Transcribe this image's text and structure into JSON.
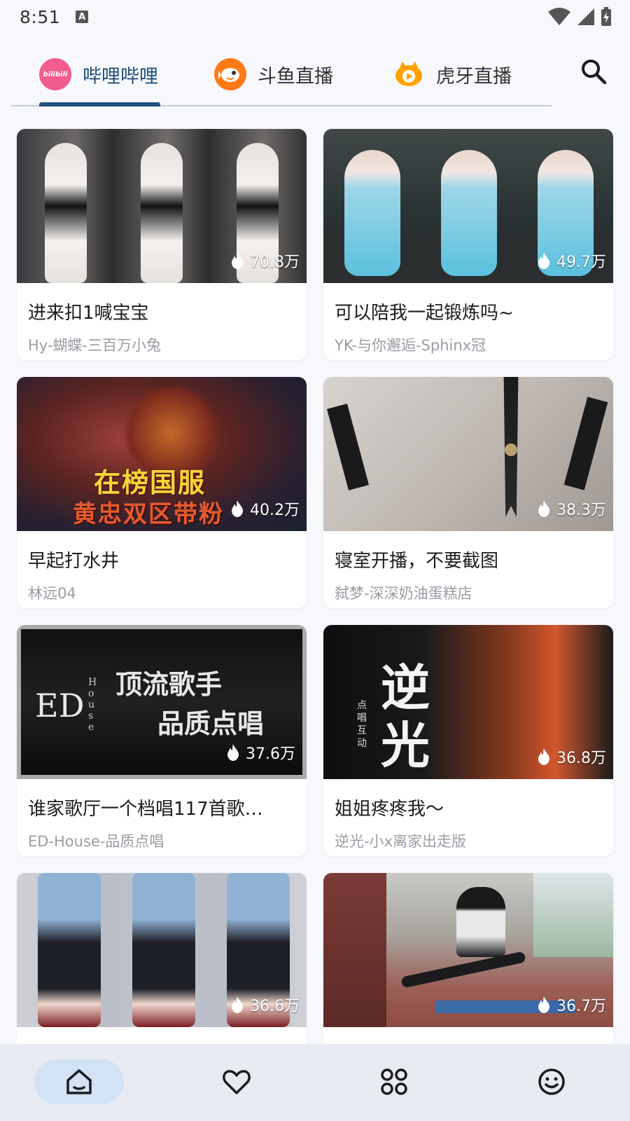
{
  "status": {
    "time": "8:51",
    "indicator": "A"
  },
  "tabs": [
    {
      "label": "哔哩哔哩",
      "logo_text": "bilibili",
      "active": true,
      "color": "#f25d8e"
    },
    {
      "label": "斗鱼直播",
      "active": false,
      "color": "#ff7a16"
    },
    {
      "label": "虎牙直播",
      "active": false,
      "color": "#ffa200"
    }
  ],
  "thumb_text": {
    "card3_banner_top": "在榜国服",
    "card3_banner_bottom": "黄忠双区带粉",
    "card5_line1": "顶流歌手",
    "card5_line2": "品质点唱",
    "card5_logo": "ED",
    "card5_logo_vertical": "House",
    "card6_big1": "逆",
    "card6_big2": "光",
    "card6_small": "点唱互动"
  },
  "cards": [
    {
      "title": "进来扣1喊宝宝",
      "author": "Hy-蝴蝶-三百万小兔",
      "viewers": "70.8万"
    },
    {
      "title": "可以陪我一起锻炼吗~",
      "author": "YK-与你邂逅-Sphinx冠",
      "viewers": "49.7万"
    },
    {
      "title": "早起打水井",
      "author": "林远04",
      "viewers": "40.2万"
    },
    {
      "title": "寝室开播，不要截图",
      "author": "弑梦-深深奶油蛋糕店",
      "viewers": "38.3万"
    },
    {
      "title": "谁家歌厅一个档唱117首歌…",
      "author": "ED-House-品质点唱",
      "viewers": "37.6万"
    },
    {
      "title": "姐姐疼疼我～",
      "author": "逆光-小x离家出走版",
      "viewers": "36.8万"
    },
    {
      "title": "",
      "author": "",
      "viewers": "36.6万"
    },
    {
      "title": "",
      "author": "",
      "viewers": "36.7万"
    }
  ],
  "bottom_nav": [
    {
      "icon": "home-icon",
      "active": true
    },
    {
      "icon": "heart-icon",
      "active": false
    },
    {
      "icon": "grid-icon",
      "active": false
    },
    {
      "icon": "smiley-icon",
      "active": false
    }
  ],
  "colors": {
    "accent": "#1f4f7a",
    "nav_active": "#d2e3f5",
    "background": "#f7f8fc"
  }
}
